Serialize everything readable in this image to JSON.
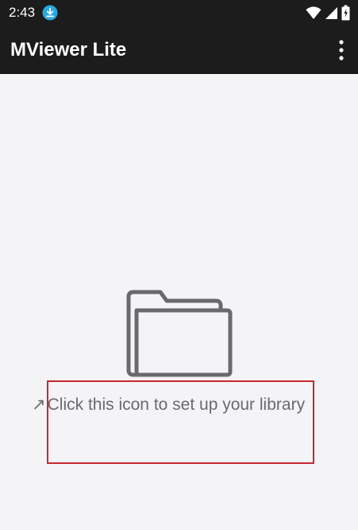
{
  "status_bar": {
    "time": "2:43",
    "icons": [
      "download-icon",
      "wifi-icon",
      "cellular-icon",
      "battery-icon"
    ]
  },
  "app_bar": {
    "title": "MViewer Lite",
    "menu_icon": "more-vert-icon"
  },
  "empty_state": {
    "icon": "folder-icon",
    "arrow": "↗",
    "message": "Click this icon to set up your library"
  },
  "colors": {
    "bar_background": "#1c1c1c",
    "content_background": "#f4f4f6",
    "icon_gray": "#6a6a6c",
    "download_badge": "#29a8e0",
    "highlight": "#c8262e"
  }
}
